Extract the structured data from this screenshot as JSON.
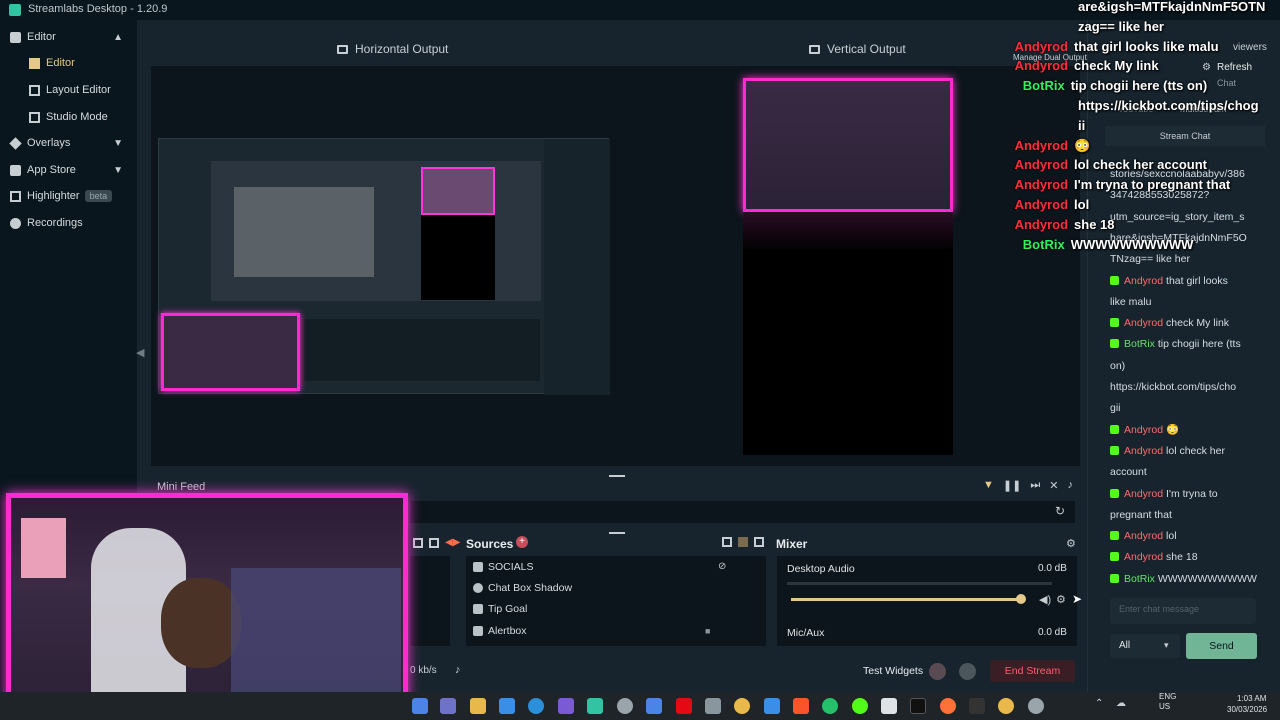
{
  "app": {
    "title": "Streamlabs Desktop - 1.20.9"
  },
  "sidebar": {
    "editor": "Editor",
    "editor_sub": "Editor",
    "layout_editor": "Layout Editor",
    "studio_mode": "Studio Mode",
    "overlays": "Overlays",
    "app_store": "App Store",
    "highlighter": "Highlighter",
    "highlighter_badge": "beta",
    "recordings": "Recordings"
  },
  "outputs": {
    "horizontal": "Horizontal Output",
    "vertical": "Vertical Output"
  },
  "mini_feed": "Mini Feed",
  "sources": {
    "title": "Sources",
    "items": [
      "SOCIALS",
      "Chat Box Shadow",
      "Tip Goal",
      "Alertbox"
    ]
  },
  "mixer": {
    "title": "Mixer",
    "channels": [
      {
        "name": "Desktop Audio",
        "level": "0.0 dB",
        "volume": 0.99
      },
      {
        "name": "Mic/Aux",
        "level": "0.0 dB"
      }
    ]
  },
  "footer": {
    "bitrate": "0 kb/s",
    "test_widgets": "Test Widgets",
    "end_stream": "End Stream"
  },
  "chat_header": {
    "viewers": "viewers",
    "refresh": "Refresh",
    "chat": "Chat",
    "youtube": "YouTube",
    "multistream": "Multistream",
    "stream_chat": "Stream Chat",
    "manage_dual_output": "Manage Dual Output"
  },
  "chat_overlay": [
    {
      "user": "",
      "text": "are&igsh=MTFkajdnNmF5OTN"
    },
    {
      "user": "",
      "text": "zag== like her"
    },
    {
      "user": "Andyrod",
      "text": "that girl looks like malu"
    },
    {
      "user": "Andyrod",
      "text": "check My link"
    },
    {
      "user": "BotRix",
      "text": "tip chogii here (tts on)"
    },
    {
      "user": "",
      "text": "https://kickbot.com/tips/chog"
    },
    {
      "user": "",
      "text": "ii"
    },
    {
      "user": "Andyrod",
      "text": "😳"
    },
    {
      "user": "Andyrod",
      "text": "lol check her account"
    },
    {
      "user": "Andyrod",
      "text": "I'm tryna to pregnant that"
    },
    {
      "user": "Andyrod",
      "text": "lol"
    },
    {
      "user": "Andyrod",
      "text": "she 18"
    },
    {
      "user": "BotRix",
      "text": "WWWWWWWWWW"
    }
  ],
  "chat_panel": {
    "lines": [
      {
        "user": "",
        "text": "stories/sexccnolaababyv/386"
      },
      {
        "user": "",
        "text": "3474288553025872?"
      },
      {
        "user": "",
        "text": "utm_source=ig_story_item_s"
      },
      {
        "user": "",
        "text": "hare&igsh=MTFkajdnNmF5O"
      },
      {
        "user": "",
        "text": "TNzag== like her"
      },
      {
        "user": "Andyrod",
        "text": "that girl looks"
      },
      {
        "user": "",
        "text": "like malu"
      },
      {
        "user": "Andyrod",
        "text": "check My link"
      },
      {
        "user": "BotRix",
        "text": "tip chogii here (tts"
      },
      {
        "user": "",
        "text": "on)"
      },
      {
        "user": "",
        "text": "https://kickbot.com/tips/cho"
      },
      {
        "user": "",
        "text": "gii"
      },
      {
        "user": "Andyrod",
        "text": "😳"
      },
      {
        "user": "Andyrod",
        "text": "lol check her"
      },
      {
        "user": "",
        "text": "account"
      },
      {
        "user": "Andyrod",
        "text": "I'm tryna to"
      },
      {
        "user": "",
        "text": "pregnant that"
      },
      {
        "user": "Andyrod",
        "text": "lol"
      },
      {
        "user": "Andyrod",
        "text": "she 18"
      },
      {
        "user": "BotRix",
        "text": "WWWWWWWWWW"
      }
    ],
    "input_placeholder": "Enter chat message",
    "filter": "All",
    "send": "Send"
  },
  "taskbar": {
    "lang": "ENG",
    "region": "US",
    "time": "1:03 AM",
    "date": "30/03/2026"
  }
}
